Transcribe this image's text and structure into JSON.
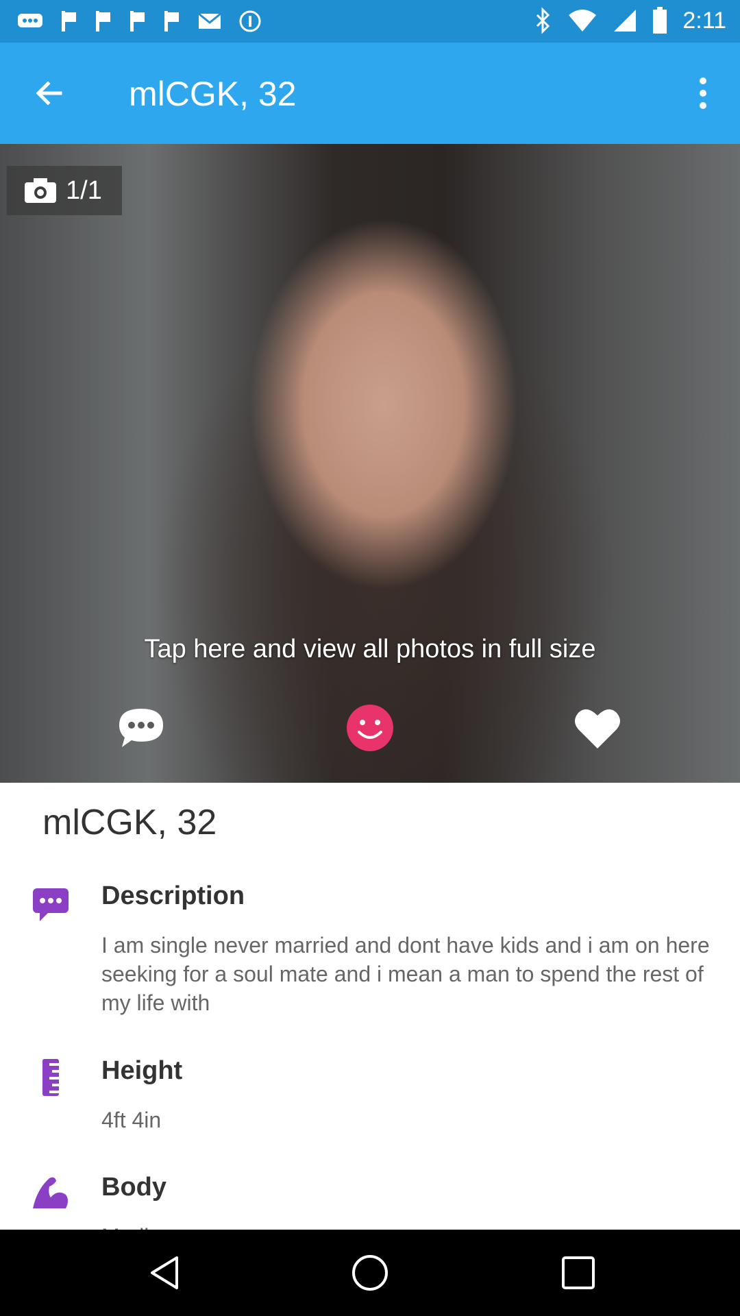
{
  "status_bar": {
    "time": "2:11",
    "left_icons": [
      "chat-bubbles-icon",
      "flag-icon",
      "flag-icon",
      "flag-icon",
      "flag-icon",
      "email-icon",
      "info-circle-icon"
    ],
    "right_icons": [
      "bluetooth-icon",
      "wifi-icon",
      "signal-icon",
      "battery-icon"
    ]
  },
  "app_bar": {
    "title": "mlCGK, 32",
    "background": "#2fa7ee"
  },
  "photo": {
    "counter": "1/1",
    "tap_hint": "Tap here and view all photos in full size",
    "actions": [
      "chat-icon",
      "smile-icon",
      "heart-icon"
    ],
    "accent": "#e8336b"
  },
  "profile": {
    "name": "mlCGK, 32",
    "sections": [
      {
        "icon": "chat-bubble-icon",
        "title": "Description",
        "value": "I am single never married and dont have kids and i am on here seeking for a soul mate and i mean a man to spend the rest of my life with"
      },
      {
        "icon": "ruler-icon",
        "title": "Height",
        "value": "4ft 4in"
      },
      {
        "icon": "muscle-icon",
        "title": "Body",
        "value": "Medium"
      }
    ],
    "icon_color": "#8b3fc4"
  },
  "nav_bar": {
    "buttons": [
      "back-icon",
      "home-icon",
      "recents-icon"
    ]
  }
}
